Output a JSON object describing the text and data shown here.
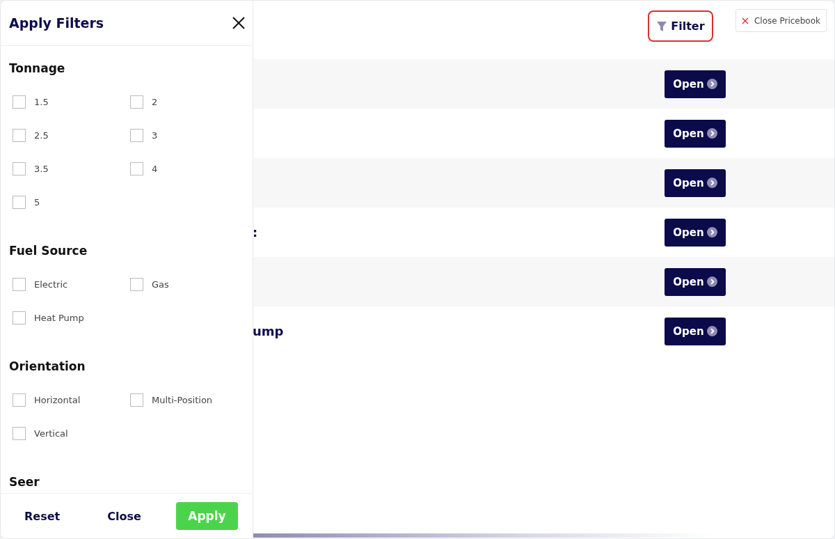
{
  "toolbar": {
    "filter_button": "Filter",
    "close_button": "Close Pricebook"
  },
  "rows": [
    {
      "button": "Open"
    },
    {
      "button": "Open"
    },
    {
      "button": "Open"
    },
    {
      "label": ":",
      "button": "Open"
    },
    {
      "button": "Open"
    },
    {
      "label": "ump",
      "button": "Open"
    }
  ],
  "drawer": {
    "title": "Apply Filters",
    "sections": [
      {
        "title": "Tonnage",
        "options": [
          {
            "label": "1.5",
            "checked": false
          },
          {
            "label": "2",
            "checked": false
          },
          {
            "label": "2.5",
            "checked": false
          },
          {
            "label": "3",
            "checked": false
          },
          {
            "label": "3.5",
            "checked": false
          },
          {
            "label": "4",
            "checked": false
          },
          {
            "label": "5",
            "checked": false
          }
        ]
      },
      {
        "title": "Fuel Source",
        "options": [
          {
            "label": "Electric",
            "checked": false
          },
          {
            "label": "Gas",
            "checked": false
          },
          {
            "label": "Heat Pump",
            "checked": false
          }
        ]
      },
      {
        "title": "Orientation",
        "options": [
          {
            "label": "Horizontal",
            "checked": false
          },
          {
            "label": "Multi-Position",
            "checked": false
          },
          {
            "label": "Vertical",
            "checked": false
          }
        ]
      },
      {
        "title": "Seer"
      }
    ],
    "footer": {
      "reset": "Reset",
      "close": "Close",
      "apply": "Apply"
    }
  }
}
